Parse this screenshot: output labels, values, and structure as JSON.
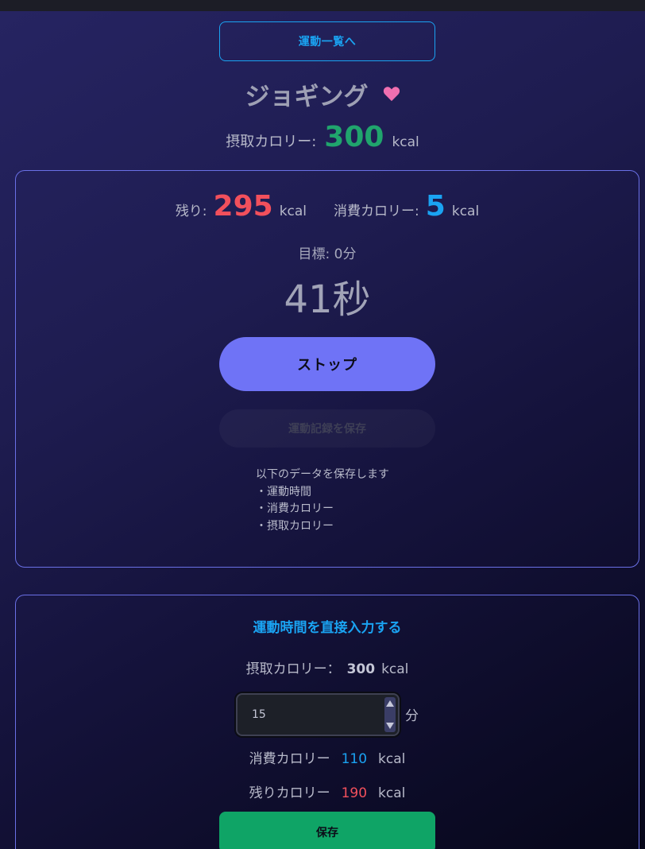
{
  "nav": {
    "back_label": "運動一覧へ"
  },
  "exercise": {
    "title": "ジョギング",
    "favorite_icon": "heart-icon"
  },
  "intake": {
    "label": "摂取カロリー:",
    "value": "300",
    "unit": "kcal"
  },
  "session": {
    "remaining_label": "残り:",
    "remaining_value": "295",
    "remaining_unit": "kcal",
    "burned_label": "消費カロリー:",
    "burned_value": "5",
    "burned_unit": "kcal",
    "goal_text": "目標: 0分",
    "timer_text": "41秒",
    "stop_label": "ストップ",
    "save_record_label": "運動記録を保存",
    "note_lines": [
      "以下のデータを保存します",
      "・運動時間",
      "・消費カロリー",
      "・摂取カロリー"
    ]
  },
  "direct": {
    "title": "運動時間を直接入力する",
    "intake_label": "摂取カロリー：",
    "intake_value": "300",
    "intake_unit": "kcal",
    "minutes_value": "15",
    "minutes_unit": "分",
    "burned_label": "消費カロリー",
    "burned_value": "110",
    "burned_unit": "kcal",
    "remaining_label": "残りカロリー",
    "remaining_value": "190",
    "remaining_unit": "kcal",
    "save_label": "保存"
  },
  "colors": {
    "accent_blue": "#1aa3f2",
    "intake_green": "#20a56d",
    "remaining_red": "#f2505c",
    "stop_button": "#6f73f6",
    "save_button": "#0fa466",
    "heart_pink": "#f06fb0"
  }
}
